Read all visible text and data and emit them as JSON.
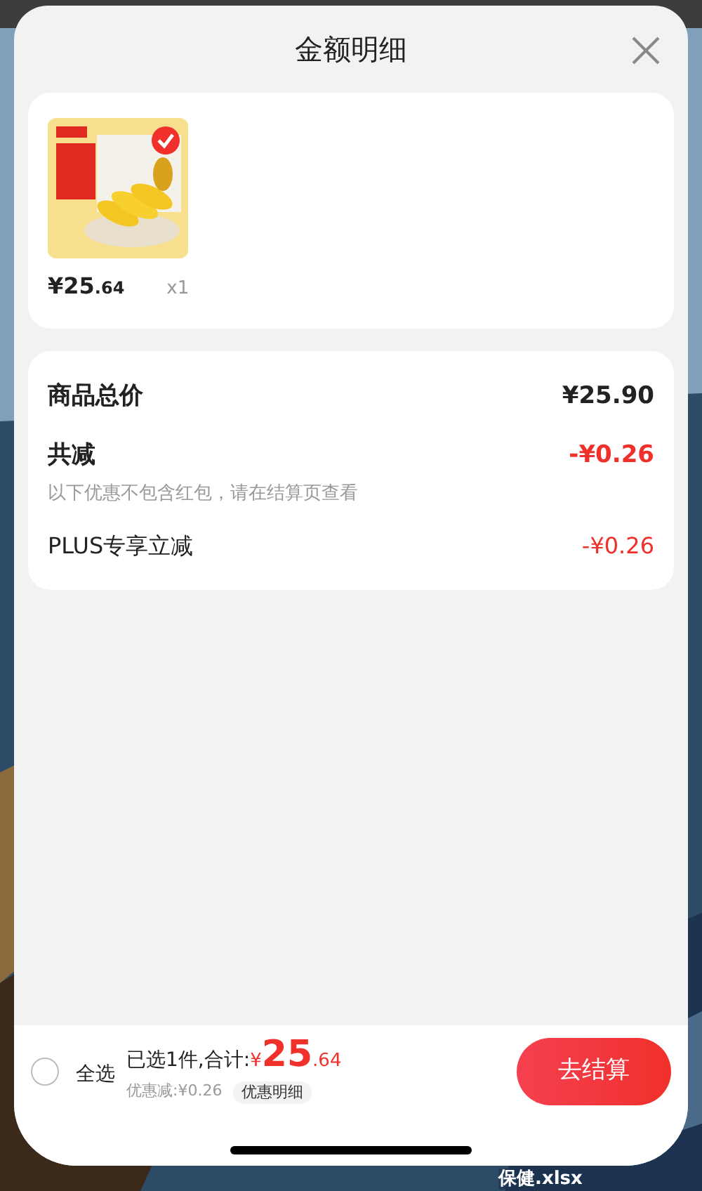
{
  "sheet": {
    "title": "金额明细"
  },
  "products": [
    {
      "price_main": "¥25",
      "price_cents": ".64",
      "quantity": "x1",
      "selected": true
    }
  ],
  "summary": {
    "rows": [
      {
        "kind": "total",
        "label": "商品总价",
        "value": "¥25.90"
      },
      {
        "kind": "discount_total",
        "label": "共减",
        "value": "-¥0.26",
        "note": "以下优惠不包含红包，请在结算页查看"
      },
      {
        "kind": "discount_item",
        "label": "PLUS专享立减",
        "value": "-¥0.26"
      }
    ]
  },
  "bottom_bar": {
    "select_all": {
      "label": "全选",
      "checked": false
    },
    "selected_text": "已选1件,合计:",
    "currency": "¥",
    "total_main": "25",
    "total_cents": ".64",
    "discount_text": "优惠减:¥0.26",
    "detail_button": "优惠明细",
    "checkout_button": "去结算"
  },
  "desktop": {
    "file_label": "保健.xlsx"
  }
}
